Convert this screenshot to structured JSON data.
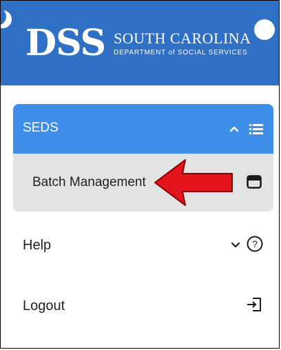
{
  "header": {
    "logo_mark": "DSS",
    "logo_state": "SOUTH CAROLINA",
    "logo_dept": "DEPARTMENT of SOCIAL SERVICES"
  },
  "nav": {
    "seds": {
      "label": "SEDS",
      "icon": "list-icon",
      "expand_icon": "chevron-up-icon"
    },
    "batch_management": {
      "label": "Batch Management",
      "icon": "card-icon",
      "highlighted": true
    },
    "help": {
      "label": "Help",
      "icon": "help-icon",
      "expand_icon": "chevron-down-icon"
    },
    "logout": {
      "label": "Logout",
      "icon": "logout-icon"
    }
  },
  "colors": {
    "header_bg": "#2f6fc4",
    "seds_bg": "#3f8ee8",
    "submenu_bg": "#e3e3e3",
    "arrow": "#e3141b"
  }
}
